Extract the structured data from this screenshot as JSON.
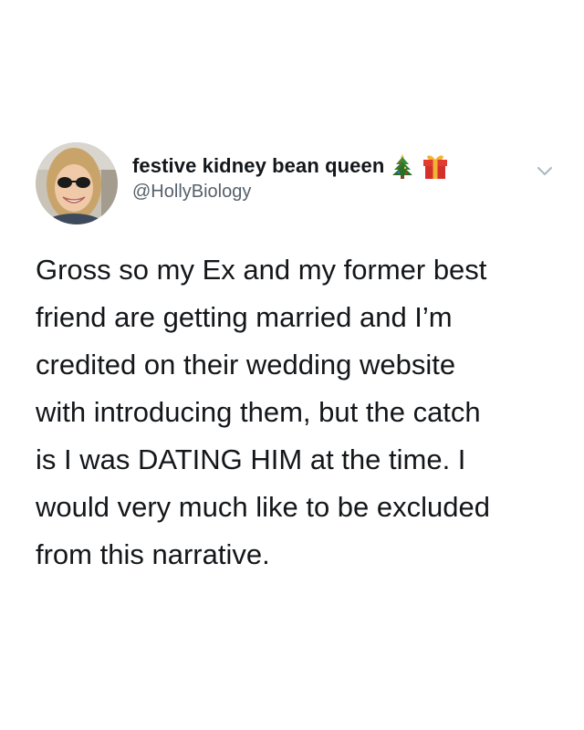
{
  "tweet": {
    "author": {
      "display_name": "festive kidney bean queen",
      "handle": "@HollyBiology",
      "name_emojis": [
        "christmas-tree-icon",
        "gift-icon"
      ]
    },
    "menu_icon": "chevron-down-icon",
    "text_lines": [
      "Gross so my Ex and my former best",
      "friend are getting married and I’m",
      "credited on their wedding website",
      "with introducing them, but the catch",
      "is I was DATING HIM at the time. I",
      "would very much like to be excluded",
      "from this narrative."
    ]
  },
  "colors": {
    "background": "#ffffff",
    "text": "#14171a",
    "handle": "#56616b",
    "chevron": "#aab8c2"
  }
}
